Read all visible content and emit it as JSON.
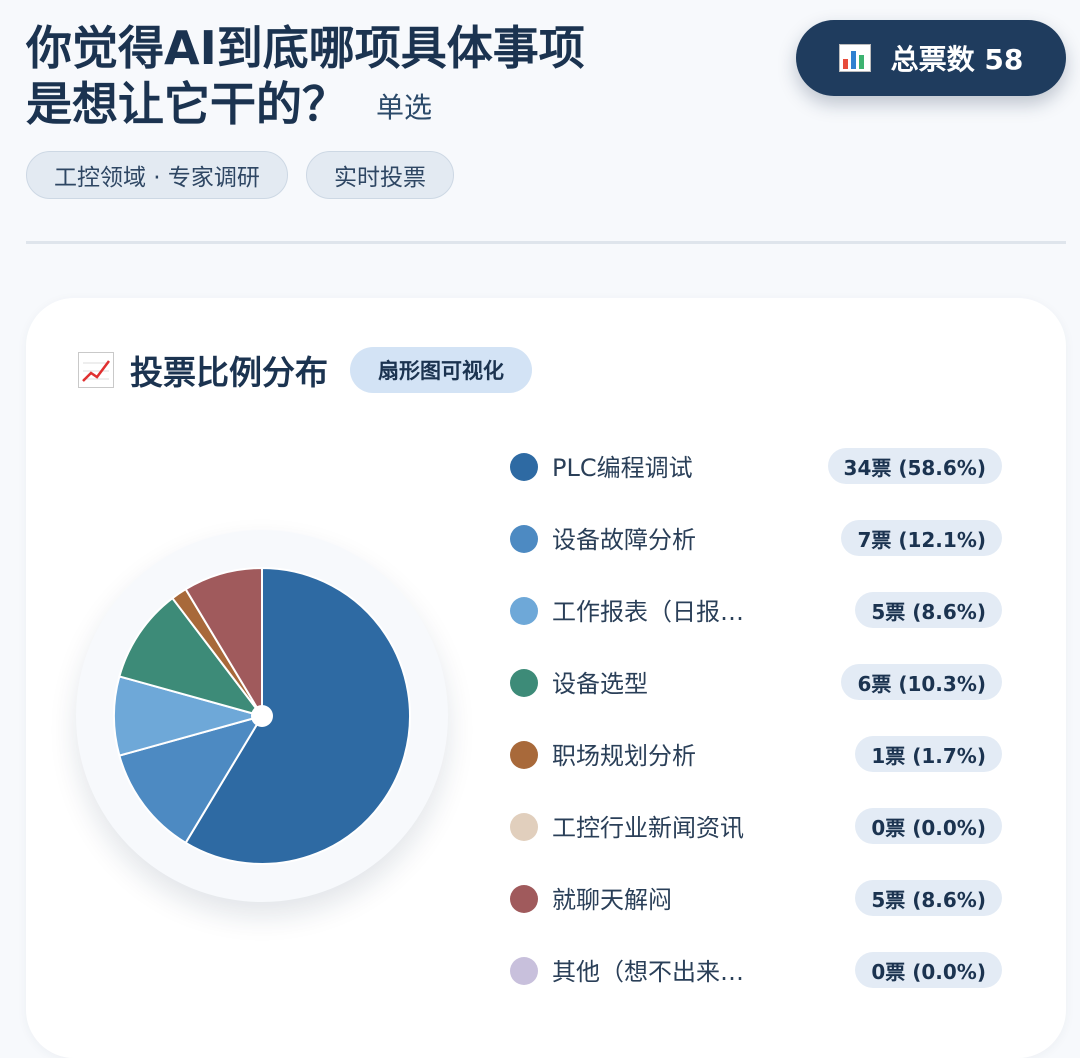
{
  "question": {
    "line1": "你觉得AI到底哪项具体事项",
    "line2": "是想让它干的？",
    "mode": "单选"
  },
  "tags": [
    "工控领域 · 专家调研",
    "实时投票"
  ],
  "total": {
    "icon": "bar-chart-icon",
    "label": "总票数 58"
  },
  "card": {
    "icon": "trend-chart-icon",
    "title": "投票比例分布",
    "pill": "扇形图可视化"
  },
  "chart_data": {
    "type": "pie",
    "title": "投票比例分布",
    "total": 58,
    "categories": [
      "PLC编程调试",
      "设备故障分析",
      "工作报表（日报…",
      "设备选型",
      "职场规划分析",
      "工控行业新闻资讯",
      "就聊天解闷",
      "其他（想不出来…"
    ],
    "values": [
      34,
      7,
      5,
      6,
      1,
      0,
      5,
      0
    ],
    "labels": [
      "34票 (58.6%)",
      "7票 (12.1%)",
      "5票 (8.6%)",
      "6票 (10.3%)",
      "1票 (1.7%)",
      "0票 (0.0%)",
      "5票 (8.6%)",
      "0票 (0.0%)"
    ],
    "colors": [
      "#2e6aa3",
      "#4d8ac2",
      "#6ea8d8",
      "#3d8b78",
      "#a8693a",
      "#e1cfbd",
      "#a05a5c",
      "#c8c0dc"
    ],
    "legend_position": "right"
  }
}
